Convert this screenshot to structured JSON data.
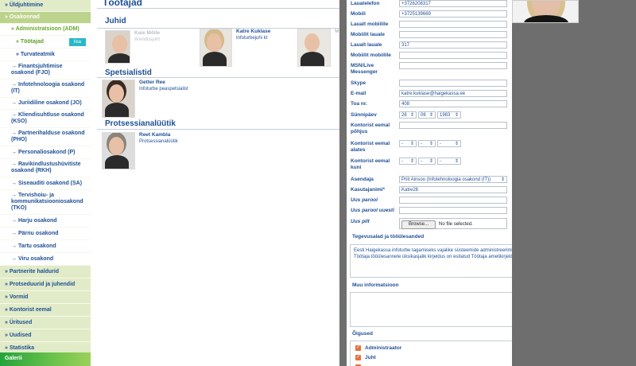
{
  "sidebar": {
    "items": [
      {
        "label": "» Üldjuhtimine",
        "type": "top"
      },
      {
        "label": "» Osakonnad",
        "type": "active"
      },
      {
        "label": "» Administratsioon (ADM)",
        "type": "sub"
      },
      {
        "label": "» Töötajad",
        "type": "sub2",
        "badge": "lisa"
      },
      {
        "label": "» Turvateatmik",
        "type": "sub2"
      },
      {
        "label": "→ Finantsjuhtimise osakond (FJO)",
        "type": "sub"
      },
      {
        "label": "→ Infotehnoloogia osakond (IT)",
        "type": "sub"
      },
      {
        "label": "→ Juriidiline osakond (JO)",
        "type": "sub"
      },
      {
        "label": "→ Kliendisuhtluse osakond (KSO)",
        "type": "sub"
      },
      {
        "label": "→ Partnerihalduse osakond (PHO)",
        "type": "sub"
      },
      {
        "label": "→ Personaliosakond (P)",
        "type": "sub"
      },
      {
        "label": "→ Ravikindlustushüvitiste osakond (RKH)",
        "type": "sub"
      },
      {
        "label": "→ Siseauditi osakond (SA)",
        "type": "sub"
      },
      {
        "label": "→ Tervishoiu- ja kommunikatsiooniosakond (TKO)",
        "type": "sub"
      },
      {
        "label": "→ Harju osakond",
        "type": "sub"
      },
      {
        "label": "→ Pärnu osakond",
        "type": "sub"
      },
      {
        "label": "→ Tartu osakond",
        "type": "sub"
      },
      {
        "label": "→ Viru osakond",
        "type": "sub"
      },
      {
        "label": "» Partnerite haldurid",
        "type": "top"
      },
      {
        "label": "» Protseduurid ja juhendid",
        "type": "top"
      },
      {
        "label": "» Vormid",
        "type": "top"
      },
      {
        "label": "» Kontorist eemal",
        "type": "top"
      },
      {
        "label": "» Üritused",
        "type": "top"
      },
      {
        "label": "» Uudised",
        "type": "top"
      },
      {
        "label": "» Statistika",
        "type": "top"
      }
    ],
    "galerii": "Galerii"
  },
  "main": {
    "title": "Töötajad",
    "sections": {
      "juhid": "Juhid",
      "spetsialistid": "Spetsialistid",
      "protsessianaluutik": "Protsessianalüütik"
    },
    "people": [
      {
        "name": "Kaie Mölle",
        "role": "Arendusjuht"
      },
      {
        "name": "Katre Kuklase",
        "role": "Infoturbejuhi kt"
      },
      {
        "name": "Getter Ree",
        "role": "Infoturbe peaspetsialist"
      },
      {
        "name": "Reet Kambla",
        "role": "Protsessianalüütik"
      }
    ],
    "partial_name": "M"
  },
  "form": {
    "fields": [
      {
        "label": "Lauatelefon",
        "value": "+3726208317"
      },
      {
        "label": "Mobiil",
        "value": "+3725139669"
      },
      {
        "label": "Laualt mobiilile",
        "value": ""
      },
      {
        "label": "Mobiilit lauale",
        "value": ""
      },
      {
        "label": "Laualt lauale",
        "value": "317"
      },
      {
        "label": "Mobiilit mobiilile",
        "value": ""
      },
      {
        "label": "MSN/Live Messenger",
        "value": ""
      },
      {
        "label": "Skype",
        "value": ""
      },
      {
        "label": "E-mail",
        "value": "katre.kuklase@haigekassa.ee"
      },
      {
        "label": "Toa nr.",
        "value": "408"
      }
    ],
    "birthday": {
      "label": "Sünnipäev",
      "day": "26",
      "month": "06",
      "year": "1983"
    },
    "away_reason": {
      "label": "Kontorist eemal põhjus",
      "value": ""
    },
    "away_from": {
      "label": "Kontorist eemal alates",
      "d": "-",
      "m": "-",
      "y": "-"
    },
    "away_until": {
      "label": "Kontorist eemal kuni",
      "d": "-",
      "m": "-",
      "y": "-"
    },
    "substitute": {
      "label": "Asendaja",
      "value": "Priit Ainsoo (Infotehnoloogia osakond (IT))"
    },
    "username": {
      "label": "Kasutajanimi*",
      "value": "Katre26"
    },
    "new_password": {
      "label": "Uus parool",
      "value": ""
    },
    "new_password_again": {
      "label": "Uus parool uuesti",
      "value": ""
    },
    "new_picture": {
      "label": "Uus pilt",
      "button": "Browse...",
      "status": "No file selected."
    },
    "duties": {
      "heading": "Tegevusalad ja tööülesanded",
      "text": "Eesti Haigekassa infoturbe tagamiseks vajalike süsteemide administreerimine ja kontrollide juurutamine. Töötaja tööülesannete üksikasjalik kirjeldus on esitatud Töötaja ametikirjelduses."
    },
    "other_info": {
      "heading": "Muu informatsioon",
      "text": ""
    },
    "rights": {
      "heading": "Õigused",
      "items": [
        {
          "label": "Administraator",
          "checked": true
        },
        {
          "label": "Juht",
          "checked": true
        }
      ]
    }
  },
  "colors": {
    "link_blue": "#1f4f96",
    "sidebar_active": "#bcd38c",
    "badge_cyan": "#28b8c8",
    "checkbox_orange": "#e66f3c",
    "overlay": "#6e6e6e"
  }
}
